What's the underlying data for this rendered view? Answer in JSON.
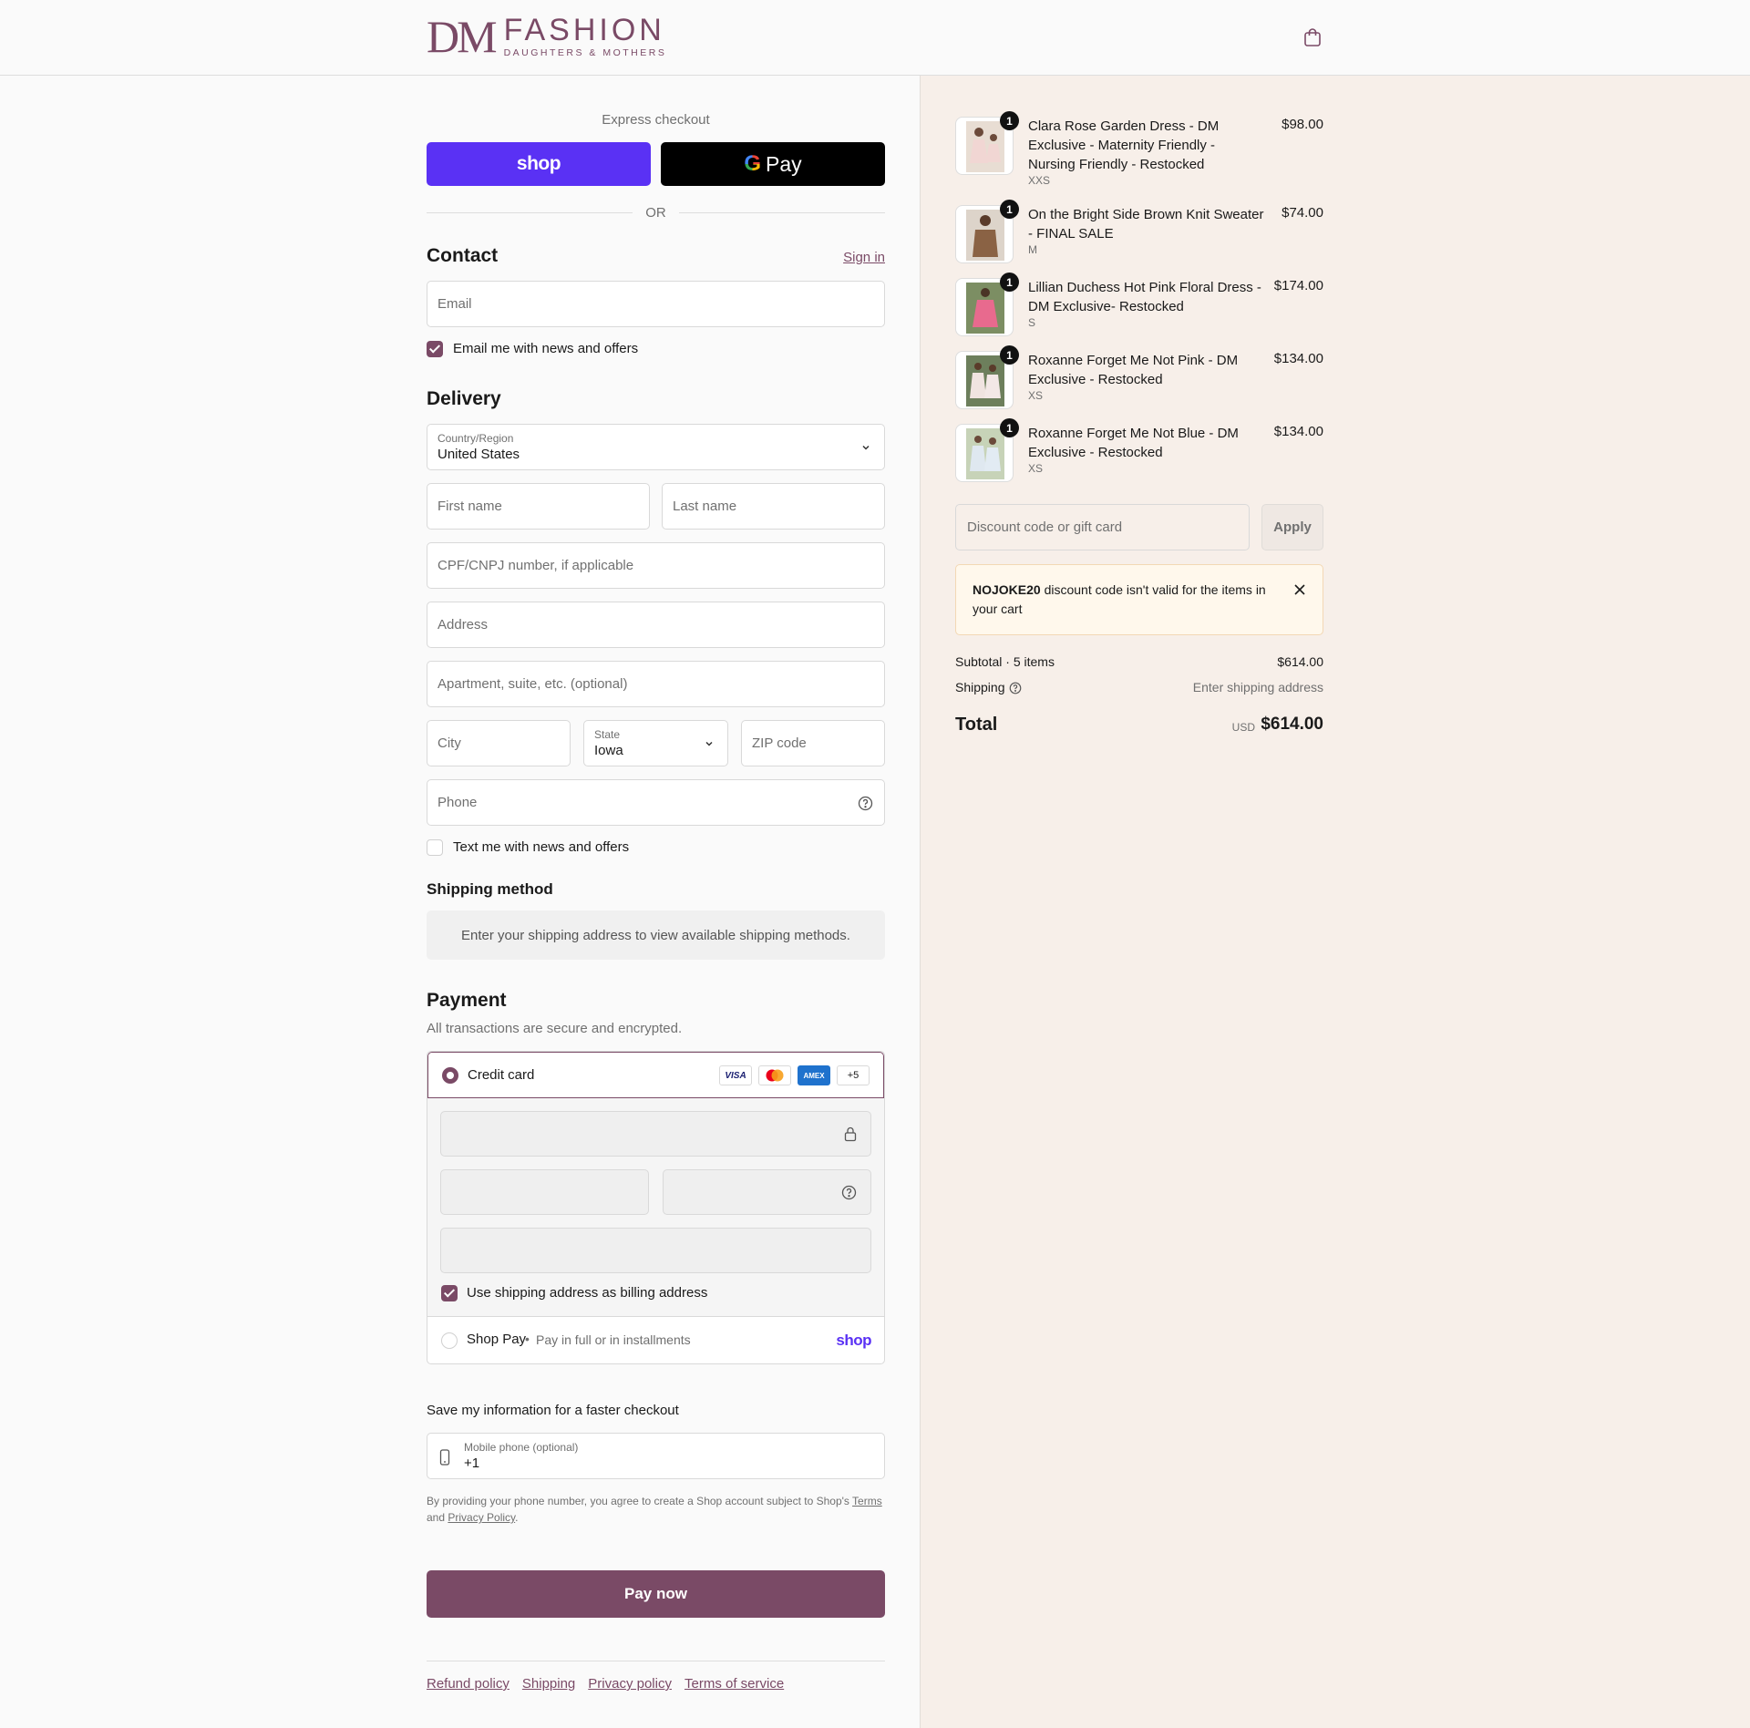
{
  "header": {
    "logo": {
      "initials": "DM",
      "word": "FASHION",
      "tagline": "DAUGHTERS & MOTHERS"
    },
    "cart_icon": "bag-icon"
  },
  "express": {
    "title": "Express checkout",
    "shop_label": "shop",
    "gpay_g": "G",
    "gpay_label": "Pay",
    "or_label": "OR"
  },
  "contact": {
    "title": "Contact",
    "signin": "Sign in",
    "email_placeholder": "Email",
    "email_news_label": "Email me with news and offers",
    "email_news_checked": true
  },
  "delivery": {
    "title": "Delivery",
    "country_label": "Country/Region",
    "country_value": "United States",
    "first_name": "First name",
    "last_name": "Last name",
    "cpf": "CPF/CNPJ number, if applicable",
    "address": "Address",
    "apartment": "Apartment, suite, etc. (optional)",
    "city": "City",
    "state_label": "State",
    "state_value": "Iowa",
    "zip": "ZIP code",
    "phone": "Phone",
    "text_news_label": "Text me with news and offers",
    "text_news_checked": false
  },
  "shipping_method": {
    "title": "Shipping method",
    "message": "Enter your shipping address to view available shipping methods."
  },
  "payment": {
    "title": "Payment",
    "subtitle": "All transactions are secure and encrypted.",
    "credit_card_label": "Credit card",
    "cards": [
      "VISA",
      "mastercard",
      "AMEX",
      "+5"
    ],
    "billing_same_label": "Use shipping address as billing address",
    "billing_same_checked": true,
    "shoppay_label": "Shop Pay",
    "shoppay_sub": "Pay in full or in installments",
    "shoppay_brand": "shop"
  },
  "save_info": {
    "title": "Save my information for a faster checkout",
    "phone_label": "Mobile phone (optional)",
    "phone_value": "+1",
    "legal_prefix": "By providing your phone number, you agree to create a Shop account subject to Shop's",
    "legal_terms": "Terms",
    "legal_and": "and",
    "legal_privacy": "Privacy Policy",
    "legal_end": "."
  },
  "pay_now": "Pay now",
  "footer": {
    "links": [
      "Refund policy",
      "Shipping",
      "Privacy policy",
      "Terms of service"
    ]
  },
  "summary": {
    "items": [
      {
        "name": "Clara Rose Garden Dress - DM Exclusive - Maternity Friendly - Nursing Friendly - Restocked",
        "size": "XXS",
        "price": "$98.00",
        "qty": "1"
      },
      {
        "name": "On the Bright Side Brown Knit Sweater - FINAL SALE",
        "size": "M",
        "price": "$74.00",
        "qty": "1"
      },
      {
        "name": "Lillian Duchess Hot Pink Floral Dress - DM Exclusive- Restocked",
        "size": "S",
        "price": "$174.00",
        "qty": "1"
      },
      {
        "name": "Roxanne Forget Me Not Pink - DM Exclusive - Restocked",
        "size": "XS",
        "price": "$134.00",
        "qty": "1"
      },
      {
        "name": "Roxanne Forget Me Not Blue - DM Exclusive - Restocked",
        "size": "XS",
        "price": "$134.00",
        "qty": "1"
      }
    ],
    "discount_placeholder": "Discount code or gift card",
    "apply_label": "Apply",
    "alert_code": "NOJOKE20",
    "alert_text": " discount code isn't valid for the items in your cart",
    "subtotal_label": "Subtotal · 5 items",
    "subtotal_value": "$614.00",
    "shipping_label": "Shipping",
    "shipping_value": "Enter shipping address",
    "total_label": "Total",
    "total_currency": "USD",
    "total_value": "$614.00"
  },
  "colors": {
    "accent": "#7a4a66",
    "shop_purple": "#5a31f4",
    "summary_bg": "#f7efe9"
  }
}
